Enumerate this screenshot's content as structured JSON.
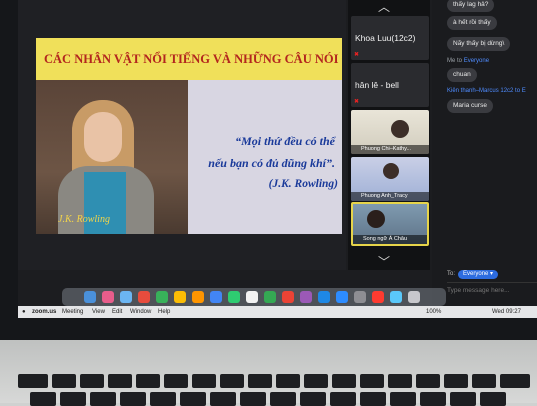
{
  "slide": {
    "title": "CÁC NHÂN VẬT NỔI TIẾNG VÀ NHỮNG CÂU NÓI ĐỂ ĐỜI",
    "photo_caption": "J.K. Rowling",
    "quote_line1": "“Mọi thứ đều có thể",
    "quote_line2": "nếu bạn có đủ dũng khí”.",
    "author": "(J.K. Rowling)"
  },
  "participants": [
    {
      "name": "Khoa Luu(12c2)"
    },
    {
      "name": "hân lê - bell"
    },
    {
      "name": "Phuong Chi–Kathy..."
    },
    {
      "name": "Phuong Anh_Tracy"
    },
    {
      "name": "Song ngữ Á Châu"
    }
  ],
  "chat": {
    "messages": [
      {
        "text": "thấy lag hả?"
      },
      {
        "text": "à hết rồi thấy"
      },
      {
        "text": "Nãy thấy bị dừng\\"
      }
    ],
    "meta1_prefix": "Me to",
    "meta1_target": "Everyone",
    "msg_chuan": "chuan",
    "meta2": "Kiên thanh–Marcus 12c2 to E",
    "msg_maria": "Maria curse",
    "to_label": "To:",
    "to_value": "Everyone ▾",
    "input_placeholder": "Type message here..."
  },
  "menubar": {
    "items": [
      "zoom.us",
      "Meeting",
      "View",
      "Edit",
      "Window",
      "Help"
    ],
    "battery": "100%",
    "clock": "Wed 09:27"
  },
  "colors": {
    "title_bar": "#f0e05a",
    "title_text": "#b3261e",
    "quote_text": "#1a3a9a",
    "accent": "#2d6cdf"
  }
}
